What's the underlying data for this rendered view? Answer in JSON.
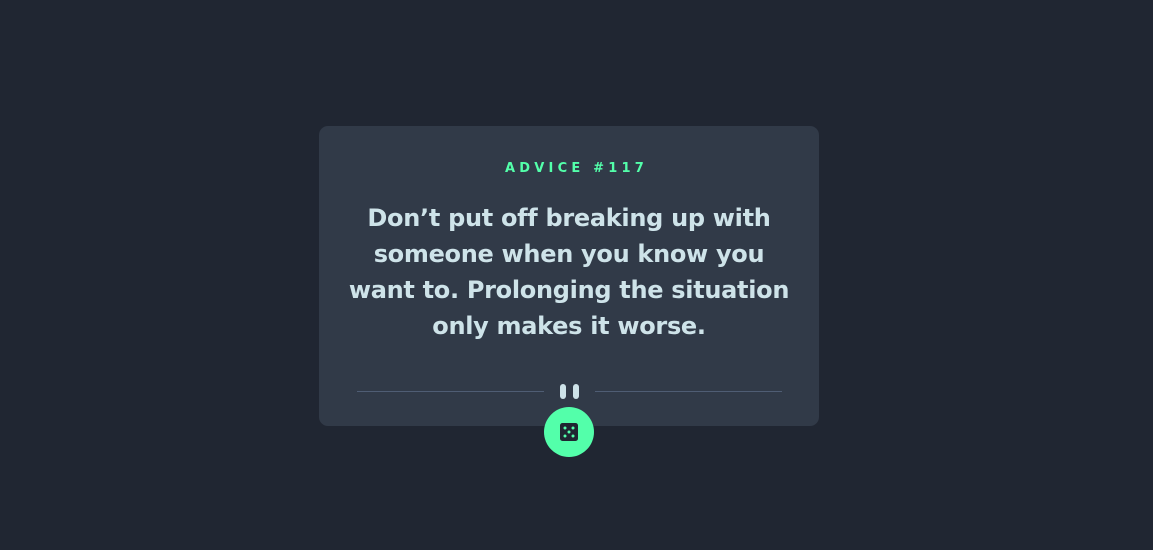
{
  "advice": {
    "id_label": "ADVICE #117",
    "quote": "Don’t put off breaking up with someone when you know you want to. Prolonging the situation only makes it worse."
  },
  "icons": {
    "divider": "pause-icon",
    "button": "dice-icon"
  },
  "colors": {
    "background": "#202632",
    "card": "#313a48",
    "accent": "#53ffaa",
    "text": "#cee3e9",
    "divider": "#4f5d74"
  }
}
